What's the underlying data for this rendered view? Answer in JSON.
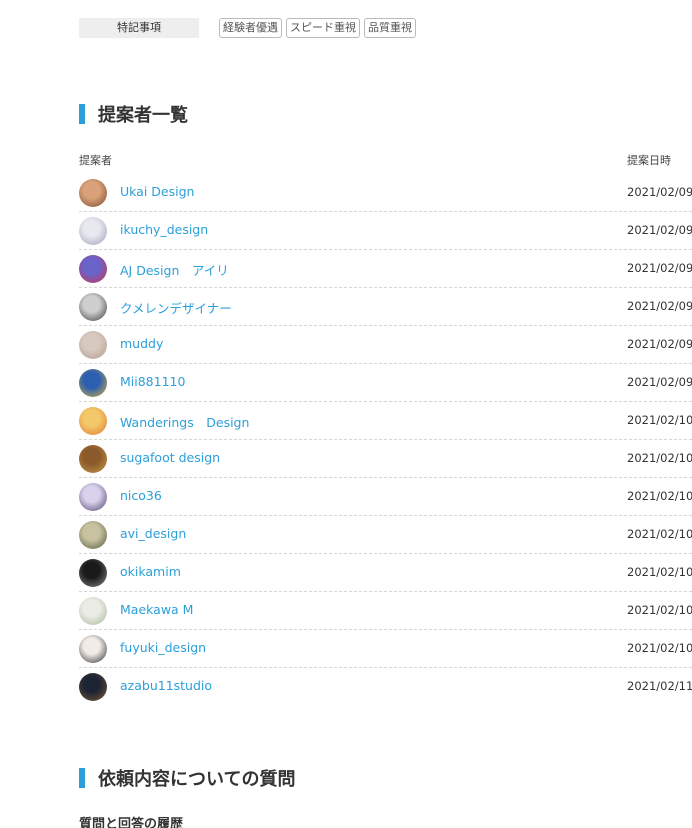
{
  "special": {
    "label": "特記事項",
    "tags": [
      "経験者優遇",
      "スピード重視",
      "品質重視"
    ]
  },
  "proposers_section": {
    "title": "提案者一覧",
    "col_proposer": "提案者",
    "col_date": "提案日時"
  },
  "proposers": [
    {
      "name": "Ukai Design",
      "date": "2021/02/09",
      "colors": [
        "#d9a27a",
        "#7a4a2e"
      ]
    },
    {
      "name": "ikuchy_design",
      "date": "2021/02/09",
      "colors": [
        "#e8e8ef",
        "#9aa0b8"
      ]
    },
    {
      "name": "AJ Design　アイリ",
      "date": "2021/02/09",
      "colors": [
        "#6a63c9",
        "#d0324a"
      ]
    },
    {
      "name": "クメレンデザイナー",
      "date": "2021/02/09",
      "colors": [
        "#cfcfcf",
        "#3a3a3a"
      ]
    },
    {
      "name": "muddy",
      "date": "2021/02/09",
      "colors": [
        "#d7c9c0",
        "#b29a8c"
      ]
    },
    {
      "name": "Mii881110",
      "date": "2021/02/09",
      "colors": [
        "#2c5fb0",
        "#d7b43a"
      ]
    },
    {
      "name": "Wanderings　Design",
      "date": "2021/02/10",
      "colors": [
        "#f3c86a",
        "#e07a2e"
      ]
    },
    {
      "name": "sugafoot design",
      "date": "2021/02/10",
      "colors": [
        "#8a5a2a",
        "#c99a4a"
      ]
    },
    {
      "name": "nico36",
      "date": "2021/02/10",
      "colors": [
        "#d9d2ec",
        "#4a3f6b"
      ]
    },
    {
      "name": "avi_design",
      "date": "2021/02/10",
      "colors": [
        "#c9c2a0",
        "#4f5a3a"
      ]
    },
    {
      "name": "okikamim",
      "date": "2021/02/10",
      "colors": [
        "#1a1a1a",
        "#8a8a8a"
      ]
    },
    {
      "name": "Maekawa M",
      "date": "2021/02/10",
      "colors": [
        "#ecece6",
        "#a3b89a"
      ]
    },
    {
      "name": "fuyuki_design",
      "date": "2021/02/10",
      "colors": [
        "#f1ece8",
        "#2a2a2a"
      ]
    },
    {
      "name": "azabu11studio",
      "date": "2021/02/11",
      "colors": [
        "#1d2433",
        "#7a5a3a"
      ]
    }
  ],
  "questions_section": {
    "title": "依頼内容についての質問",
    "history_label": "質問と回答の履歴"
  }
}
